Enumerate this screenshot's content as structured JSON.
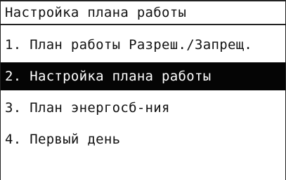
{
  "header": {
    "title": "Настройка плана работы"
  },
  "menu": {
    "selected_index": 1,
    "items": [
      {
        "label": "1. План работы Разреш./Запрещ."
      },
      {
        "label": "2. Настройка плана работы"
      },
      {
        "label": "3. План энергосб-ния"
      },
      {
        "label": "4. Первый день"
      }
    ]
  },
  "colors": {
    "selected_bg": "#050505",
    "selected_text": "#ffffff",
    "text": "#111111"
  }
}
